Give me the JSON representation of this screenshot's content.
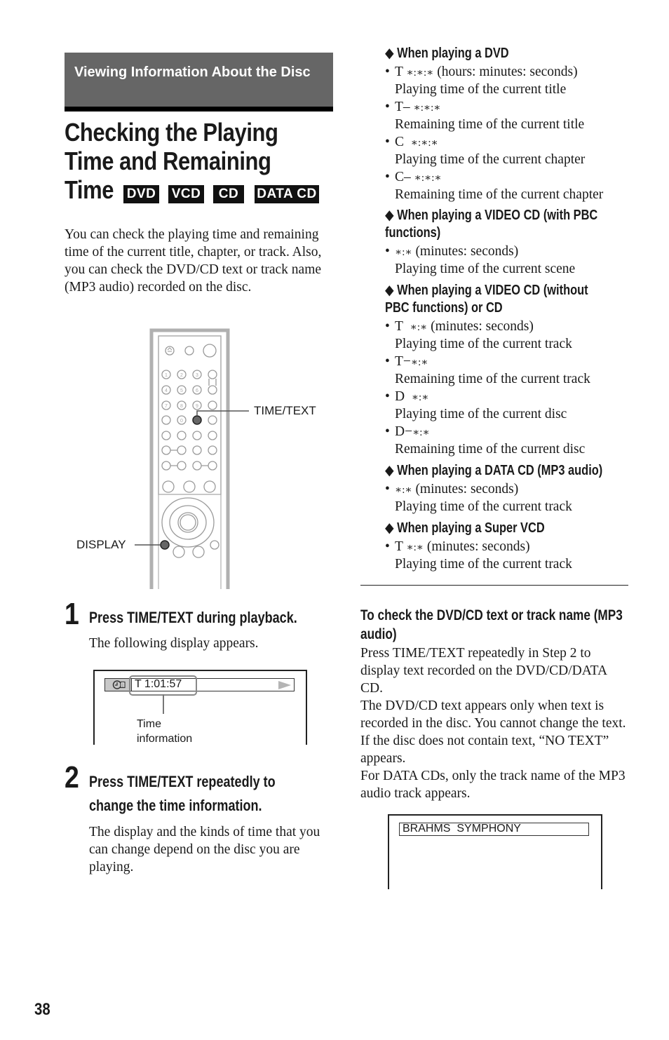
{
  "section_banner": "Viewing Information About the Disc",
  "title": {
    "lines": [
      "Checking the Playing",
      "Time and Remaining",
      "Time"
    ],
    "badges": [
      "DVD",
      "VCD",
      "CD",
      "DATA CD"
    ]
  },
  "intro": "You can check the playing time and remaining time of the current title, chapter, or track. Also, you can check the DVD/CD text or track name (MP3 audio) recorded on the disc.",
  "figure": {
    "callouts": {
      "time_text": "TIME/TEXT",
      "display": "DISPLAY"
    },
    "remote_number_buttons": [
      "1",
      "2",
      "3",
      "4",
      "5",
      "6",
      "7",
      "8",
      "9",
      "0"
    ]
  },
  "steps": [
    {
      "number": "1",
      "heading": "Press TIME/TEXT during playback.",
      "body": "The following display appears.",
      "osd": {
        "time_value": "T  1:01:57",
        "callout_line1": "Time",
        "callout_line2": "information"
      }
    },
    {
      "number": "2",
      "heading_line1": "Press TIME/TEXT repeatedly to",
      "heading_line2": "change the time information.",
      "body": "The display and the kinds of time that you can change depend on the disc you are playing."
    }
  ],
  "modes": [
    {
      "heading": "When playing a DVD",
      "items": [
        {
          "code": "T",
          "time": "∗:∗:∗",
          "note": "(hours: minutes: seconds)",
          "desc": "Playing time of the current title"
        },
        {
          "code": "T–",
          "time": "∗:∗:∗",
          "note": "",
          "desc": "Remaining time of the current title"
        },
        {
          "code": "C",
          "time": "∗:∗:∗",
          "note": "",
          "desc": "Playing time of the current chapter"
        },
        {
          "code": "C–",
          "time": "∗:∗:∗",
          "note": "",
          "desc": "Remaining time of the current chapter"
        }
      ]
    },
    {
      "heading_line1": "When playing a VIDEO CD (with PBC",
      "heading_line2": "functions)",
      "items": [
        {
          "code": "",
          "time": "∗:∗",
          "note": "(minutes: seconds)",
          "desc": "Playing time of the current scene"
        }
      ]
    },
    {
      "heading_line1": "When playing a VIDEO CD (without",
      "heading_line2": "PBC functions) or CD",
      "items": [
        {
          "code": "T",
          "time": "∗:∗",
          "note": "(minutes: seconds)",
          "desc": "Playing time of the current track"
        },
        {
          "code": "T−",
          "time": "∗:∗",
          "note": "",
          "desc": "Remaining time of the current track"
        },
        {
          "code": "D",
          "time": "∗:∗",
          "note": "",
          "desc": "Playing time of the current disc"
        },
        {
          "code": "D−",
          "time": "∗:∗",
          "note": "",
          "desc": "Remaining time of the current disc"
        }
      ]
    },
    {
      "heading": "When playing a DATA CD (MP3 audio)",
      "items": [
        {
          "code": "",
          "time": "∗:∗",
          "note": "(minutes: seconds)",
          "desc": "Playing time of the current track"
        }
      ]
    },
    {
      "heading": "When playing a Super VCD",
      "items": [
        {
          "code": "T",
          "time": "∗:∗",
          "note": "(minutes: seconds)",
          "desc": "Playing time of the current track"
        }
      ]
    }
  ],
  "text_note": {
    "heading": "To check the DVD/CD text or track name (MP3 audio)",
    "body": "Press TIME/TEXT repeatedly in Step 2 to display text recorded on the DVD/CD/DATA CD.\nThe DVD/CD text appears only when text is recorded in the disc. You cannot change the text. If the disc does not contain text, “NO TEXT” appears.\nFor DATA CDs, only the track name of the MP3 audio track appears.",
    "osd_text": "BRAHMS  SYMPHONY"
  },
  "page_number": "38",
  "colors": {
    "banner_bg": "#666666",
    "banner_text": "#ffffff",
    "badge_bg": "#111111",
    "remote_outline": "#aaaaaa",
    "osd_icon_bg": "#c8c8c8"
  }
}
